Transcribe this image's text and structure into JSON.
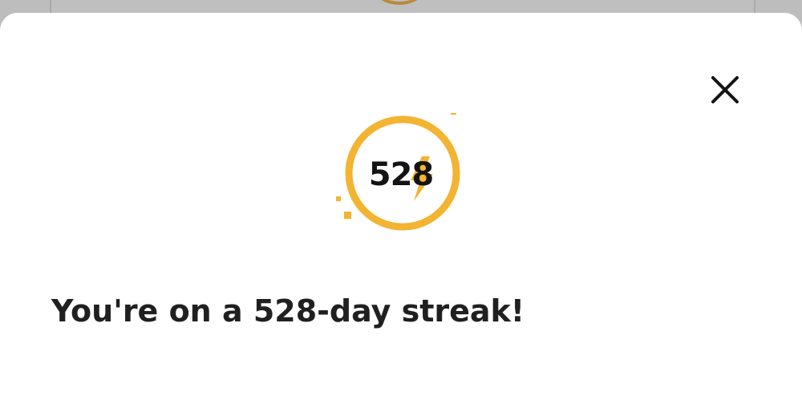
{
  "dialog": {
    "close_icon": "close-icon",
    "streak_badge": {
      "count": "528",
      "icon": "lightning-bolt-icon",
      "ring_color": "#F2B431"
    },
    "message": "You're on a 528-day streak!"
  },
  "colors": {
    "accent": "#F2B431",
    "text": "#202020",
    "backdrop": "#BDBDBD",
    "sheet": "#FFFFFF"
  }
}
